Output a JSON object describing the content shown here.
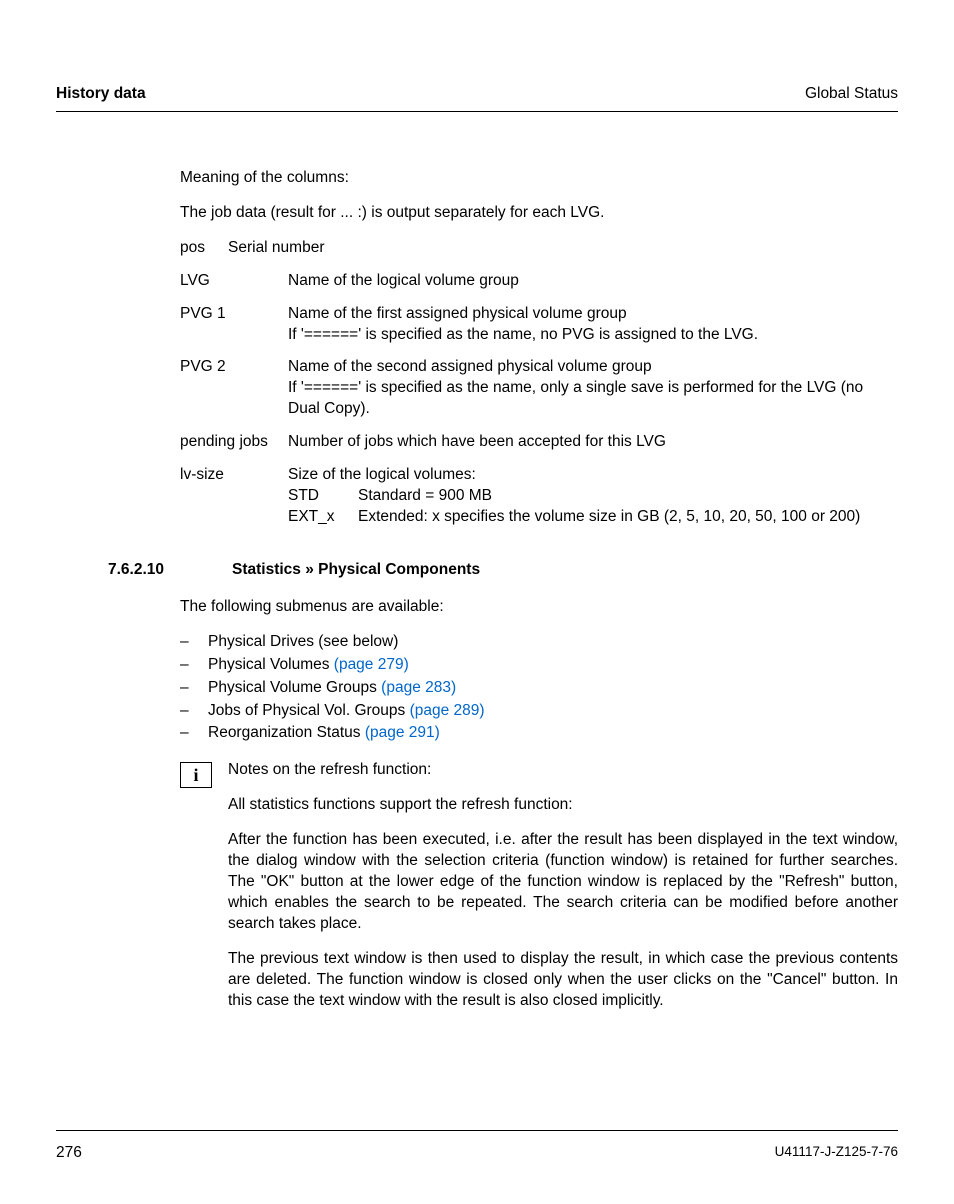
{
  "header": {
    "left": "History data",
    "right": "Global Status"
  },
  "intro": {
    "meaning": "Meaning of the columns:",
    "jobdata": "The job data (result for ... :) is output separately for each LVG."
  },
  "defs": {
    "pos_term": "pos",
    "pos_desc": "Serial number",
    "lvg_term": "LVG",
    "lvg_desc": "Name of the logical volume group",
    "pvg1_term": "PVG 1",
    "pvg1_desc": "Name of the first assigned physical volume group\nIf '======' is specified as the name, no PVG is assigned to the LVG.",
    "pvg2_term": "PVG 2",
    "pvg2_desc": "Name of the second assigned physical volume group\nIf '======' is specified as the name, only a single save is performed for the LVG (no Dual Copy).",
    "pending_term": "pending jobs",
    "pending_desc": "Number of jobs which have been accepted for this LVG",
    "lvsize_term": "lv-size",
    "lvsize_intro": "Size of the logical volumes:",
    "std_term": "STD",
    "std_desc": "Standard = 900 MB",
    "ext_term": "EXT_x",
    "ext_desc": "Extended: x specifies the volume size in GB (2, 5, 10, 20, 50, 100 or 200)"
  },
  "section": {
    "num": "7.6.2.10",
    "title": "Statistics » Physical Components",
    "intro": "The following submenus are available:"
  },
  "bullets": {
    "b1": "Physical Drives (see below)",
    "b2a": "Physical Volumes ",
    "b2l": "(page 279)",
    "b3a": "Physical Volume Groups ",
    "b3l": "(page 283)",
    "b4a": "Jobs of Physical Vol. Groups ",
    "b4l": "(page 289)",
    "b5a": "Reorganization Status ",
    "b5l": "(page 291)"
  },
  "info": {
    "icon": "i",
    "p1": "Notes on the refresh function:",
    "p2": "All statistics functions support the refresh function:",
    "p3": "After the function has been executed, i.e. after the result has been displayed in the text window, the dialog window with the selection criteria (function window) is retained for further searches. The \"OK\" button at the lower edge of the function window is replaced by the \"Refresh\" button, which enables the search to be repeated. The search criteria can be modified before another search takes place.",
    "p4": "The previous text window is then used to display the result, in which case the previous contents are deleted. The function window is closed only when the user clicks on the \"Cancel\" button. In this case the text window with the result is also closed implicitly."
  },
  "footer": {
    "page": "276",
    "docid": "U41117-J-Z125-7-76"
  },
  "dash": "–"
}
